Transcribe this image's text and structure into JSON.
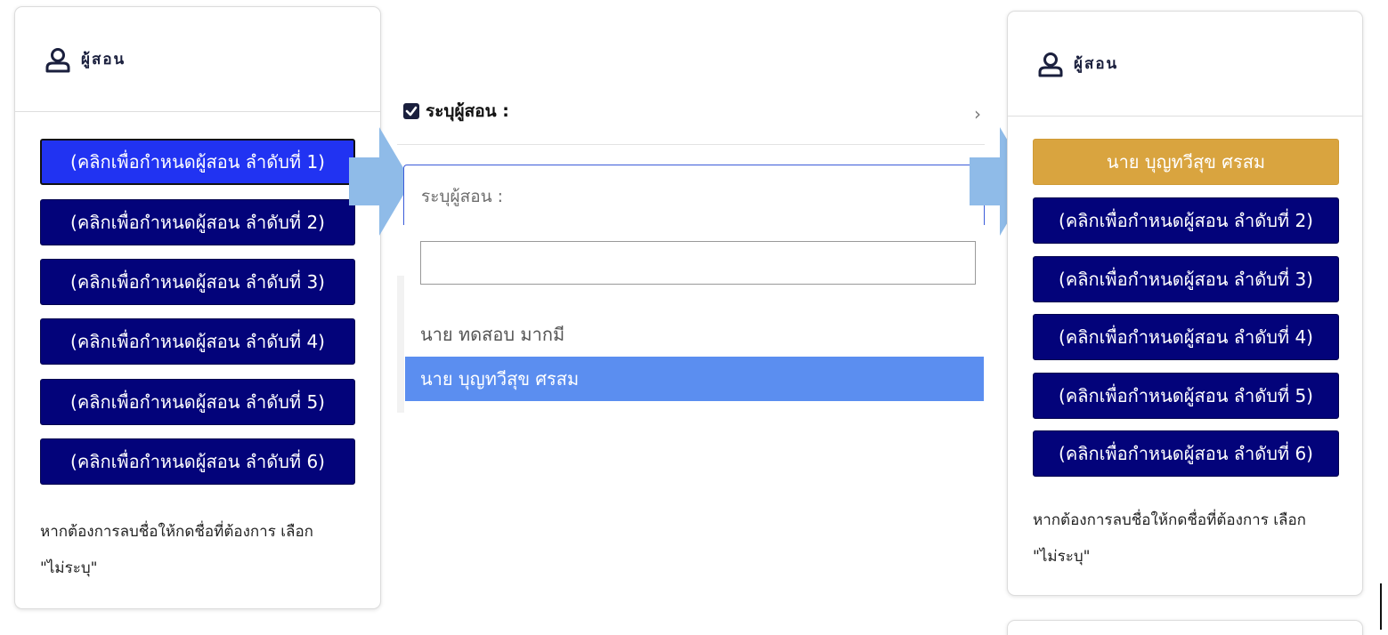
{
  "left_card": {
    "title": "ผู้สอน",
    "buttons": [
      "(คลิกเพื่อกำหนดผู้สอน ลำดับที่ 1)",
      "(คลิกเพื่อกำหนดผู้สอน ลำดับที่ 2)",
      "(คลิกเพื่อกำหนดผู้สอน ลำดับที่ 3)",
      "(คลิกเพื่อกำหนดผู้สอน ลำดับที่ 4)",
      "(คลิกเพื่อกำหนดผู้สอน ลำดับที่ 5)",
      "(คลิกเพื่อกำหนดผู้สอน ลำดับที่ 6)"
    ],
    "note_line1": "หากต้องการลบชื่อให้กดชื่อที่ต้องการ เลือก",
    "note_line2": "\"ไม่ระบุ\""
  },
  "middle": {
    "label": "ระบุผู้สอน :",
    "select_placeholder": "ระบุผู้สอน :",
    "search_value": "",
    "options": [
      "นาย ทดสอบ มากมี",
      "นาย บุญทวีสุข ศรสม"
    ],
    "highlighted_option": "นาย บุญทวีสุข ศรสม"
  },
  "right_card": {
    "title": "ผู้สอน",
    "selected_teacher": "นาย บุญทวีสุข ศรสม",
    "buttons": [
      "(คลิกเพื่อกำหนดผู้สอน ลำดับที่ 2)",
      "(คลิกเพื่อกำหนดผู้สอน ลำดับที่ 3)",
      "(คลิกเพื่อกำหนดผู้สอน ลำดับที่ 4)",
      "(คลิกเพื่อกำหนดผู้สอน ลำดับที่ 5)",
      "(คลิกเพื่อกำหนดผู้สอน ลำดับที่ 6)"
    ],
    "note_line1": "หากต้องการลบชื่อให้กดชื่อที่ต้องการ เลือก",
    "note_line2": "\"ไม่ระบุ\""
  },
  "colors": {
    "button_navy": "#03037a",
    "button_active": "#2133f2",
    "button_selected": "#d9a43f",
    "option_highlight": "#5b8ef0",
    "arrow": "#8fbbe8"
  },
  "icons": [
    "user-icon",
    "checkbox-icon",
    "chevron-right-icon",
    "arrow-right-icon"
  ]
}
